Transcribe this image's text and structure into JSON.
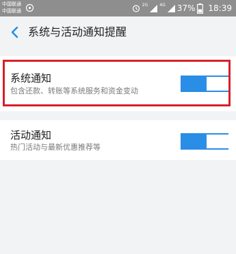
{
  "status_bar": {
    "carrier_1": "中国联通",
    "carrier_2": "中国联通",
    "net_1": "2G",
    "net_2": "4G",
    "battery_percent": "37%",
    "time": "18:39"
  },
  "header": {
    "title": "系统与活动通知提醒"
  },
  "settings": [
    {
      "title": "系统通知",
      "subtitle": "包含还款、转账等系统服务和资金变动",
      "enabled": true,
      "highlighted": true
    },
    {
      "title": "活动通知",
      "subtitle": "热门活动与最新优惠推荐等",
      "enabled": true,
      "highlighted": false
    }
  ],
  "colors": {
    "accent": "#2a8de6",
    "highlight": "#d7202a",
    "background": "#f2f3f5",
    "status_bar": "#8e8e8e"
  },
  "icons": {
    "back": "chevron-left-icon",
    "hotspot": "hotspot-icon",
    "alarm": "alarm-clock-icon",
    "signal": "signal-bars-icon",
    "battery": "battery-icon"
  }
}
